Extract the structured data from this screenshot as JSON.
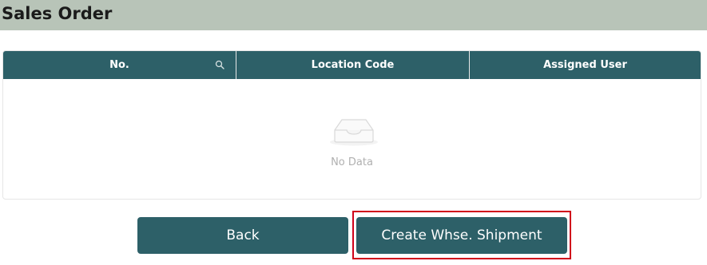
{
  "header": {
    "title": "Sales Order"
  },
  "table": {
    "columns": [
      "No.",
      "Location Code",
      "Assigned User"
    ],
    "rows": [],
    "empty_text": "No Data"
  },
  "buttons": {
    "back_label": "Back",
    "create_label": "Create Whse. Shipment"
  },
  "icons": {
    "column_search": "search-icon",
    "empty_state": "empty-inbox-icon"
  },
  "colors": {
    "header_bg": "#b8c4b8",
    "accent": "#2d6068",
    "highlight": "#d0021b"
  }
}
